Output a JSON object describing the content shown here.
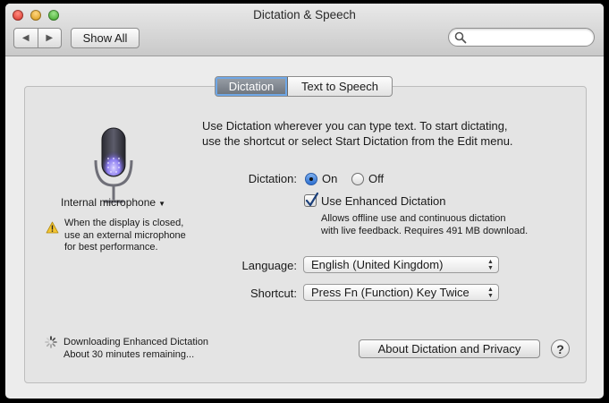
{
  "window": {
    "title": "Dictation & Speech"
  },
  "toolbar": {
    "back_icon": "back-arrow-icon",
    "forward_icon": "forward-arrow-icon",
    "show_all_label": "Show All",
    "search_placeholder": ""
  },
  "tabs": [
    {
      "label": "Dictation",
      "selected": true
    },
    {
      "label": "Text to Speech",
      "selected": false
    }
  ],
  "intro": {
    "line1": "Use Dictation wherever you can type text. To start dictating,",
    "line2": "use the shortcut or select Start Dictation from the Edit menu."
  },
  "microphone": {
    "icon": "microphone-icon",
    "source": "Internal microphone",
    "warning_lines": [
      "When the display is closed,",
      "use an external microphone",
      "for best performance."
    ]
  },
  "dictation": {
    "label": "Dictation:",
    "on_label": "On",
    "off_label": "Off",
    "selected": "On",
    "enhanced_label": "Use Enhanced Dictation",
    "enhanced_checked": true,
    "enhanced_desc_lines": [
      "Allows offline use and continuous dictation",
      "with live feedback. Requires 491 MB download."
    ]
  },
  "language": {
    "label": "Language:",
    "value": "English (United Kingdom)"
  },
  "shortcut": {
    "label": "Shortcut:",
    "value": "Press Fn (Function) Key Twice"
  },
  "download": {
    "line1": "Downloading Enhanced Dictation",
    "line2": "About 30 minutes remaining..."
  },
  "footer": {
    "about_label": "About Dictation and Privacy",
    "help_label": "?"
  },
  "colors": {
    "accent": "#2c6fd0",
    "selected_tab": "#6b727b",
    "mic_glow": "#8b7cf0"
  }
}
